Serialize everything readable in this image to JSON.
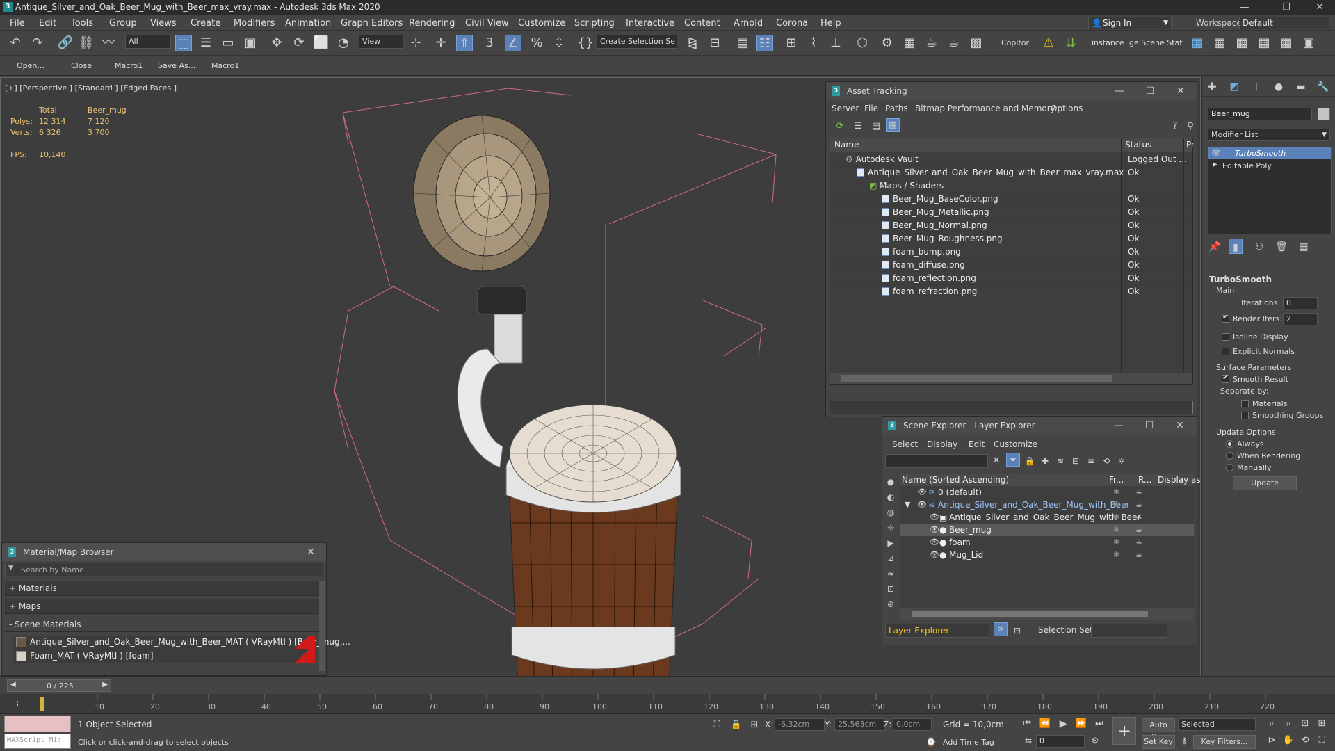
{
  "window": {
    "title": "Antique_Silver_and_Oak_Beer_Mug_with_Beer_max_vray.max - Autodesk 3ds Max 2020",
    "app_icon": "3",
    "minimize": "—",
    "restore": "❐",
    "close": "✕"
  },
  "menu": {
    "items": [
      "File",
      "Edit",
      "Tools",
      "Group",
      "Views",
      "Create",
      "Modifiers",
      "Animation",
      "Graph Editors",
      "Rendering",
      "Civil View",
      "Customize",
      "Scripting",
      "Interactive",
      "Content",
      "Arnold",
      "Corona",
      "Help"
    ],
    "sign_in": "Sign In",
    "workspaces_label": "Workspaces:",
    "workspaces_value": "Default"
  },
  "toolbar": {
    "selection_filter": "All",
    "view_dropdown": "View",
    "create_selection_set": "Create Selection Se",
    "copitor": "Copitor",
    "instance": "instance",
    "scene_stat": "ge Scene Stat"
  },
  "macrobar": {
    "buttons": [
      "Open...",
      "Close",
      "Macro1",
      "Save As...",
      "Macro1"
    ]
  },
  "viewport": {
    "label": "[+] [Perspective ] [Standard ] [Edged Faces ]",
    "stats": {
      "col_total": "Total",
      "col_object": "Beer_mug",
      "polys_label": "Polys:",
      "polys_total": "12 314",
      "polys_object": "7 120",
      "verts_label": "Verts:",
      "verts_total": "6 326",
      "verts_object": "3 700",
      "fps_label": "FPS:",
      "fps_value": "10,140"
    }
  },
  "asset_tracking": {
    "title": "Asset Tracking",
    "menu": [
      "Server",
      "File",
      "Paths",
      "Bitmap Performance and Memory",
      "Options"
    ],
    "col_name": "Name",
    "col_status": "Status",
    "col_p": "Pr",
    "rows": [
      {
        "name": "Autodesk Vault",
        "status": "Logged Out ..."
      },
      {
        "name": "Antique_Silver_and_Oak_Beer_Mug_with_Beer_max_vray.max",
        "status": "Ok"
      },
      {
        "name": "Maps / Shaders",
        "status": ""
      },
      {
        "name": "Beer_Mug_BaseColor.png",
        "status": "Ok"
      },
      {
        "name": "Beer_Mug_Metallic.png",
        "status": "Ok"
      },
      {
        "name": "Beer_Mug_Normal.png",
        "status": "Ok"
      },
      {
        "name": "Beer_Mug_Roughness.png",
        "status": "Ok"
      },
      {
        "name": "foam_bump.png",
        "status": "Ok"
      },
      {
        "name": "foam_diffuse.png",
        "status": "Ok"
      },
      {
        "name": "foam_reflection.png",
        "status": "Ok"
      },
      {
        "name": "foam_refraction.png",
        "status": "Ok"
      }
    ]
  },
  "scene_explorer": {
    "title": "Scene Explorer - Layer Explorer",
    "menu": [
      "Select",
      "Display",
      "Edit",
      "Customize"
    ],
    "col_name": "Name (Sorted Ascending)",
    "col_fr": "Fr...",
    "col_r": "R...",
    "col_display": "Display as",
    "rows": [
      {
        "name": "0 (default)"
      },
      {
        "name": "Antique_Silver_and_Oak_Beer_Mug_with_Beer"
      },
      {
        "name": "Antique_Silver_and_Oak_Beer_Mug_with_Beer"
      },
      {
        "name": "Beer_mug"
      },
      {
        "name": "foam"
      },
      {
        "name": "Mug_Lid"
      }
    ],
    "layer_explorer": "Layer Explorer",
    "selection_set_label": "Selection Set:"
  },
  "material_browser": {
    "title": "Material/Map Browser",
    "search_placeholder": "Search by Name ...",
    "sections": [
      "+ Materials",
      "+ Maps",
      "- Scene Materials"
    ],
    "materials": [
      "Antique_Silver_and_Oak_Beer_Mug_with_Beer_MAT ( VRayMtl ) [Beer_mug,...",
      "Foam_MAT ( VRayMtl ) [foam]"
    ]
  },
  "command_panel": {
    "object_name": "Beer_mug",
    "modifier_list": "Modifier List",
    "stack": [
      "TurboSmooth",
      "Editable Poly"
    ],
    "rollout_title": "TurboSmooth",
    "main_label": "Main",
    "iterations_label": "Iterations:",
    "iterations_value": "0",
    "render_iters_label": "Render Iters:",
    "render_iters_value": "2",
    "isoline": "Isoline Display",
    "explicit_normals": "Explicit Normals",
    "surface_params": "Surface Parameters",
    "smooth_result": "Smooth Result",
    "separate_by": "Separate by:",
    "materials": "Materials",
    "smoothing_groups": "Smoothing Groups",
    "update_options": "Update Options",
    "always": "Always",
    "when_rendering": "When Rendering",
    "manually": "Manually",
    "update_button": "Update"
  },
  "timeline": {
    "frame_display": "0 / 225",
    "ticks": [
      "10",
      "20",
      "30",
      "40",
      "50",
      "60",
      "70",
      "80",
      "90",
      "100",
      "110",
      "120",
      "130",
      "140",
      "150",
      "160",
      "170",
      "180",
      "190",
      "200",
      "210",
      "220"
    ]
  },
  "statusbar": {
    "maxscript": "MAXScript Mi:",
    "selected": "1 Object Selected",
    "hint": "Click or click-and-drag to select objects",
    "x_label": "X:",
    "x_value": "-6,32cm",
    "y_label": "Y:",
    "y_value": "25,563cm",
    "z_label": "Z:",
    "z_value": "0,0cm",
    "grid": "Grid = 10,0cm",
    "add_time_tag": "Add Time Tag",
    "auto_key": "Auto Key",
    "selected_dd": "Selected",
    "set_key": "Set Key",
    "key_filters": "Key Filters...",
    "frame_value": "0"
  }
}
